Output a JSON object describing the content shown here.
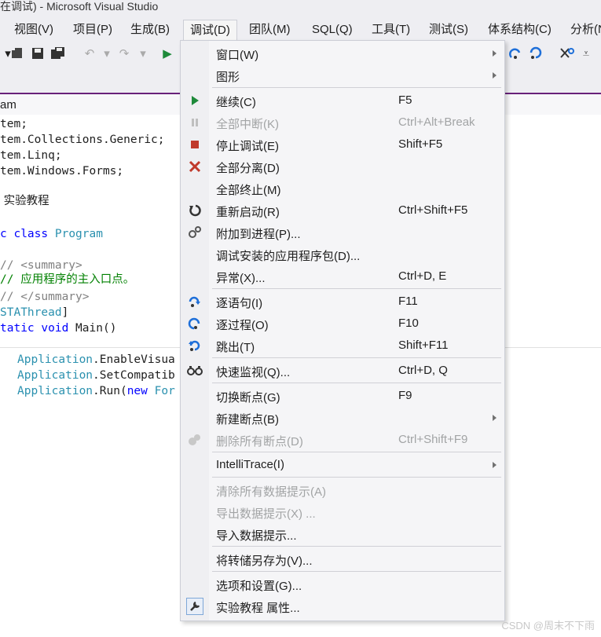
{
  "window": {
    "title": "在调试) - Microsoft Visual Studio"
  },
  "menubar": {
    "items": [
      {
        "label": "视图(V)"
      },
      {
        "label": "项目(P)"
      },
      {
        "label": "生成(B)"
      },
      {
        "label": "调试(D)"
      },
      {
        "label": "团队(M)"
      },
      {
        "label": "SQL(Q)"
      },
      {
        "label": "工具(T)"
      },
      {
        "label": "测试(S)"
      },
      {
        "label": "体系结构(C)"
      },
      {
        "label": "分析(N"
      }
    ]
  },
  "tab": {
    "label": "am"
  },
  "code": {
    "lines": [
      {
        "parts": [
          {
            "t": "tem;"
          }
        ]
      },
      {
        "parts": [
          {
            "t": "tem.Collections.Generic;"
          }
        ]
      },
      {
        "parts": [
          {
            "t": "tem.Linq;"
          }
        ]
      },
      {
        "parts": [
          {
            "t": "tem.Windows.Forms;"
          }
        ]
      },
      {
        "parts": [
          {
            "t": " 实验教程"
          }
        ]
      },
      {
        "parts": [
          {
            "t": "c ",
            "c": "kw"
          },
          {
            "t": "class ",
            "c": "kw"
          },
          {
            "t": "Program",
            "c": "ty"
          }
        ]
      },
      {
        "parts": [
          {
            "t": "// <summary>",
            "c": "cm-gray"
          }
        ]
      },
      {
        "parts": [
          {
            "t": "// 应用程序的主入口点。",
            "c": "cm"
          }
        ]
      },
      {
        "parts": [
          {
            "t": "// </summary>",
            "c": "cm-gray"
          }
        ]
      },
      {
        "parts": [
          {
            "t": "STAThread",
            "c": "ty"
          },
          {
            "t": "]"
          }
        ]
      },
      {
        "parts": [
          {
            "t": "tatic ",
            "c": "kw"
          },
          {
            "t": "void ",
            "c": "kw"
          },
          {
            "t": "Main()"
          }
        ]
      },
      {
        "parts": [
          {
            "t": "Application",
            "c": "ty"
          },
          {
            "t": ".EnableVisua"
          }
        ]
      },
      {
        "parts": [
          {
            "t": "Application",
            "c": "ty"
          },
          {
            "t": ".SetCompatib"
          }
        ]
      },
      {
        "parts": [
          {
            "t": "Application",
            "c": "ty"
          },
          {
            "t": ".Run("
          },
          {
            "t": "new ",
            "c": "kw"
          },
          {
            "t": "For",
            "c": "ty"
          }
        ]
      }
    ]
  },
  "debug_menu": {
    "items": [
      {
        "label": "窗口(W)",
        "shortcut": "",
        "submenu": true,
        "disabled": false,
        "icon": ""
      },
      {
        "label": "图形",
        "shortcut": "",
        "submenu": true,
        "disabled": false,
        "icon": ""
      },
      {
        "label": "继续(C)",
        "shortcut": "F5",
        "submenu": false,
        "disabled": false,
        "icon": "play-icon"
      },
      {
        "label": "全部中断(K)",
        "shortcut": "Ctrl+Alt+Break",
        "submenu": false,
        "disabled": true,
        "icon": "pause-icon"
      },
      {
        "label": "停止调试(E)",
        "shortcut": "Shift+F5",
        "submenu": false,
        "disabled": false,
        "icon": "stop-icon"
      },
      {
        "label": "全部分离(D)",
        "shortcut": "",
        "submenu": false,
        "disabled": false,
        "icon": "detach-x-icon"
      },
      {
        "label": "全部终止(M)",
        "shortcut": "",
        "submenu": false,
        "disabled": false,
        "icon": ""
      },
      {
        "label": "重新启动(R)",
        "shortcut": "Ctrl+Shift+F5",
        "submenu": false,
        "disabled": false,
        "icon": "restart-icon"
      },
      {
        "label": "附加到进程(P)...",
        "shortcut": "",
        "submenu": false,
        "disabled": false,
        "icon": "gears-icon"
      },
      {
        "label": "调试安装的应用程序包(D)...",
        "shortcut": "",
        "submenu": false,
        "disabled": false,
        "icon": ""
      },
      {
        "label": "异常(X)...",
        "shortcut": "Ctrl+D, E",
        "submenu": false,
        "disabled": false,
        "icon": ""
      },
      {
        "label": "逐语句(I)",
        "shortcut": "F11",
        "submenu": false,
        "disabled": false,
        "icon": "step-into-icon"
      },
      {
        "label": "逐过程(O)",
        "shortcut": "F10",
        "submenu": false,
        "disabled": false,
        "icon": "step-over-icon"
      },
      {
        "label": "跳出(T)",
        "shortcut": "Shift+F11",
        "submenu": false,
        "disabled": false,
        "icon": "step-out-icon"
      },
      {
        "label": "快速监视(Q)...",
        "shortcut": "Ctrl+D, Q",
        "submenu": false,
        "disabled": false,
        "icon": "glasses-icon"
      },
      {
        "label": "切换断点(G)",
        "shortcut": "F9",
        "submenu": false,
        "disabled": false,
        "icon": ""
      },
      {
        "label": "新建断点(B)",
        "shortcut": "",
        "submenu": true,
        "disabled": false,
        "icon": ""
      },
      {
        "label": "删除所有断点(D)",
        "shortcut": "Ctrl+Shift+F9",
        "submenu": false,
        "disabled": true,
        "icon": "delete-breakpoints-icon"
      },
      {
        "label": "IntelliTrace(I)",
        "shortcut": "",
        "submenu": true,
        "disabled": false,
        "icon": ""
      },
      {
        "label": "清除所有数据提示(A)",
        "shortcut": "",
        "submenu": false,
        "disabled": true,
        "icon": ""
      },
      {
        "label": "导出数据提示(X) ...",
        "shortcut": "",
        "submenu": false,
        "disabled": true,
        "icon": ""
      },
      {
        "label": "导入数据提示...",
        "shortcut": "",
        "submenu": false,
        "disabled": false,
        "icon": ""
      },
      {
        "label": "将转储另存为(V)...",
        "shortcut": "",
        "submenu": false,
        "disabled": false,
        "icon": ""
      },
      {
        "label": "选项和设置(G)...",
        "shortcut": "",
        "submenu": false,
        "disabled": false,
        "icon": ""
      },
      {
        "label": "实验教程 属性...",
        "shortcut": "",
        "submenu": false,
        "disabled": false,
        "icon": "wrench-icon"
      }
    ]
  },
  "watermark": "CSDN @周末不下雨",
  "colors": {
    "accent": "#68217a",
    "play": "#1e8a3a",
    "stop": "#c0392b",
    "step": "#1e6fd9"
  }
}
